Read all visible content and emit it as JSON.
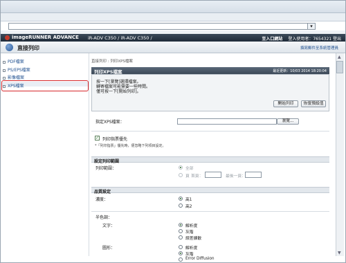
{
  "header": {
    "logo": "imageRUNNER ADVANCE",
    "device": "iR-ADV C350 / iR-ADV C350 /",
    "portal_link": "至入口網站",
    "login_text": "登入使用者：7654321 登出",
    "page_title": "直接列印",
    "mail_link": "撰寫郵件至系統管理員"
  },
  "sidebar": {
    "items": [
      {
        "label": "PDF檔案"
      },
      {
        "label": "PS/EPS檔案"
      },
      {
        "label": "影像檔案"
      },
      {
        "label": "XPS檔案"
      }
    ]
  },
  "main": {
    "breadcrumb": "直接列印 : 列印XPS檔案",
    "panel_title": "列印XPS檔案",
    "last_update": "最近更新：10/03 2014 18:20:04",
    "messages": [
      "按一下[瀏覽]選擇檔案。",
      "轉寄檔案可能需要一些時間。",
      "僅可按一下[開始列印]。"
    ],
    "start_print": "開始列印",
    "restore_defaults": "恢復預設值",
    "file_label": "指定XPS檔案：",
    "browse": "瀏覽...",
    "print_ticket_label": "列印指票優先",
    "print_ticket_note": "*「列印指票」優先時，便忽略下列項目設定。",
    "range_section": "設定列印範圍",
    "range_label": "列印範圍：",
    "range_all": "全部",
    "range_pages": "頁",
    "range_first": "首頁：",
    "range_last": "最後一頁：",
    "quality_section": "品質設定",
    "resolution_label": "濃度：",
    "res_high1": "高1",
    "res_high2": "高2",
    "halftone_label": "半色調：",
    "text_label": "文字：",
    "text_opt1": "解析度",
    "text_opt2": "灰階",
    "text_opt3": "誤差擴散",
    "graphics_label": "圖形：",
    "gfx_opt1": "解析度",
    "gfx_opt2": "灰階",
    "gfx_opt3": "Error Diffusion"
  }
}
